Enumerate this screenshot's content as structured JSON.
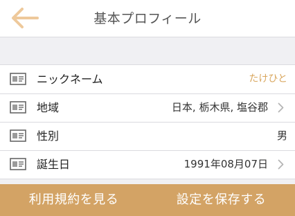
{
  "header": {
    "title": "基本プロフィール",
    "back_icon": "arrow-left-icon",
    "accent_color": "#eec99b"
  },
  "profile_rows": [
    {
      "label": "ニックネーム",
      "value": "たけひと",
      "icon": "id-card-icon",
      "has_chevron": false
    },
    {
      "label": "地域",
      "value": "日本, 栃木県, 塩谷郡",
      "icon": "id-card-icon",
      "has_chevron": true
    },
    {
      "label": "性別",
      "value": "男",
      "icon": "id-card-icon",
      "has_chevron": false
    },
    {
      "label": "誕生日",
      "value": "1991年08月07日",
      "icon": "id-card-icon",
      "has_chevron": true
    }
  ],
  "bottom_bar": {
    "terms_label": "利用規約を見る",
    "save_label": "設定を保存する",
    "color": "#d3a365"
  },
  "colors": {
    "value_accent": "#d9a75f",
    "background": "#f0f0f3"
  }
}
